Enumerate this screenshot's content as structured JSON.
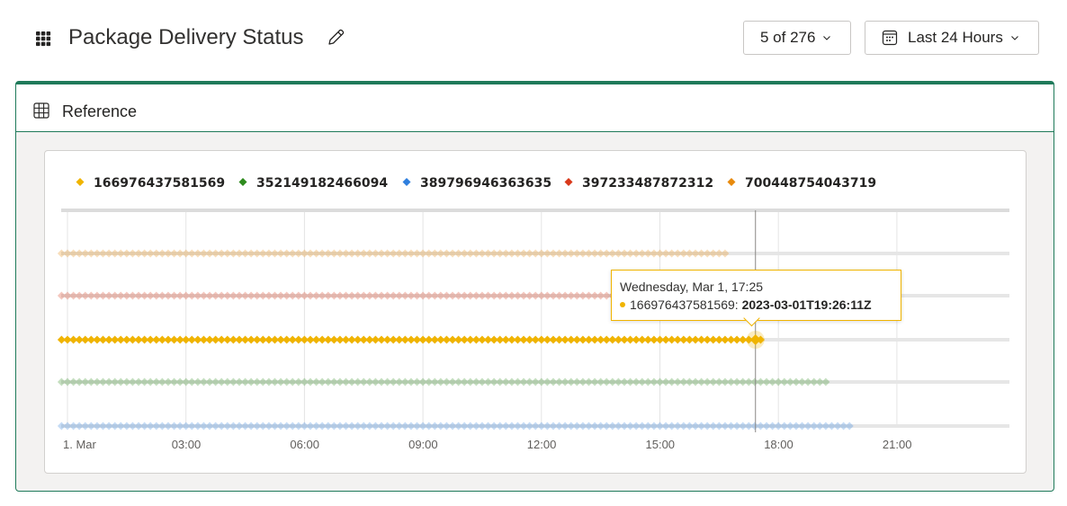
{
  "header": {
    "title": "Package Delivery Status",
    "icons": {
      "app": "grid-icon",
      "edit": "pencil-icon"
    },
    "count_selector": {
      "label": "5 of 276"
    },
    "range_selector": {
      "label": "Last 24 Hours",
      "icon": "calendar-icon"
    }
  },
  "card": {
    "title": "Reference",
    "icon": "table-icon",
    "accent": "#1f7a5a"
  },
  "chart_data": {
    "type": "scatter",
    "title": "",
    "xlabel": "",
    "ylabel": "",
    "x_ticks": [
      "1. Mar",
      "03:00",
      "06:00",
      "09:00",
      "12:00",
      "15:00",
      "18:00",
      "21:00"
    ],
    "x_range_hours": [
      -0.15,
      24
    ],
    "legend_placement": "top-left",
    "grid": true,
    "crosshair_time": "Wednesday, Mar 1, 17:25",
    "series": [
      {
        "name": "166976437581569",
        "color": "#f0b400",
        "start_hour": -0.15,
        "end_hour": 17.6,
        "highlighted": true
      },
      {
        "name": "352149182466094",
        "color": "#2e8b1e",
        "start_hour": -0.15,
        "end_hour": 19.2,
        "highlighted": false
      },
      {
        "name": "389796946363635",
        "color": "#2f7fde",
        "start_hour": -0.15,
        "end_hour": 19.9,
        "highlighted": false
      },
      {
        "name": "397233487872312",
        "color": "#d9391b",
        "start_hour": -0.15,
        "end_hour": 17.2,
        "highlighted": false
      },
      {
        "name": "700448754043719",
        "color": "#e88a0c",
        "start_hour": -0.15,
        "end_hour": 16.7,
        "highlighted": false
      }
    ],
    "tooltip": {
      "title": "Wednesday, Mar 1, 17:25",
      "series": "166976437581569",
      "series_label": "166976437581569:",
      "value": "2023-03-01T19:26:11Z"
    }
  }
}
